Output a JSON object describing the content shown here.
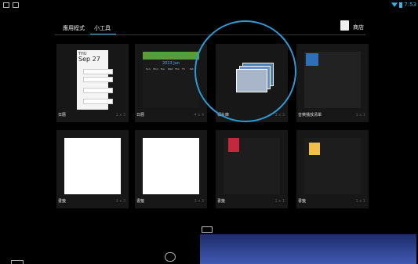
{
  "tabs": [
    {
      "label": "應用程式"
    },
    {
      "label": "小工具"
    }
  ],
  "shop_label": "商店",
  "status": {
    "clock": "7:53"
  },
  "widgets": [
    {
      "name": "日曆",
      "size": "1 x 3"
    },
    {
      "name": "日曆",
      "size": "4 x 4"
    },
    {
      "name": "相片庫",
      "size": "3 x 3"
    },
    {
      "name": "音樂播放清單",
      "size": "1 x 1"
    },
    {
      "name": "書籤",
      "size": "3 x 3"
    },
    {
      "name": "書籤",
      "size": "3 x 3"
    },
    {
      "name": "書籤",
      "size": "1 x 1"
    },
    {
      "name": "書籤",
      "size": "1 x 1"
    }
  ],
  "calendar_preview": {
    "date": "Sep 27",
    "header": "THU"
  },
  "month_preview": {
    "title": "2013 Jan",
    "weekdays": [
      "Sun",
      "Mon",
      "Tue",
      "Wed",
      "Thu",
      "Fri",
      "Sat"
    ]
  },
  "colors": {
    "accent": "#35b5e5",
    "highlight_circle": "#2f9bd6"
  }
}
